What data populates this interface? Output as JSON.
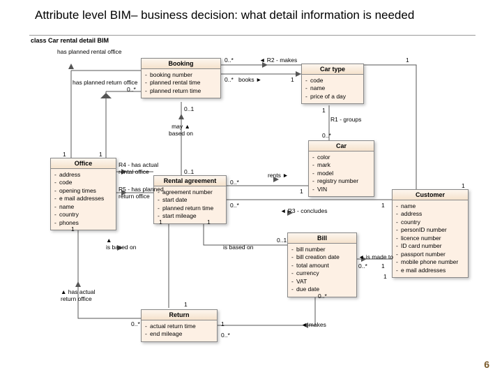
{
  "slide": {
    "title": "Attribute level BIM– business decision: what detail information is needed",
    "page_number": "6"
  },
  "diagram_label": "class Car rental detail BIM",
  "classes": {
    "booking": {
      "name": "Booking",
      "attrs": [
        "booking number",
        "planned rental time",
        "planned return time"
      ]
    },
    "cartype": {
      "name": "Car type",
      "attrs": [
        "code",
        "name",
        "price of a day"
      ]
    },
    "car": {
      "name": "Car",
      "attrs": [
        "color",
        "mark",
        "model",
        "registry number",
        "VIN"
      ]
    },
    "office": {
      "name": "Office",
      "attrs": [
        "address",
        "code",
        "opening times",
        "e mail addresses",
        "name",
        "country",
        "phones"
      ]
    },
    "rental": {
      "name": "Rental agreement",
      "attrs": [
        "agreement number",
        "start date",
        "planned return time",
        "start mileage"
      ]
    },
    "bill": {
      "name": "Bill",
      "attrs": [
        "bill number",
        "bill creation date",
        "total amount",
        "currency",
        "VAT",
        "due date"
      ]
    },
    "customer": {
      "name": "Customer",
      "attrs": [
        "name",
        "address",
        "country",
        "personID number",
        "licence number",
        "ID card number",
        "passport number",
        "mobile phone number",
        "e mail addresses"
      ]
    },
    "return": {
      "name": "Return",
      "attrs": [
        "actual return time",
        "end mileage"
      ]
    }
  },
  "labels": {
    "hasPlannedRentalOffice": "has planned rental office",
    "hasPlannedReturnOffice": "has planned return office",
    "r2makes": "R2 - makes",
    "books": "books",
    "mayBasedOn": "may based on",
    "r1groups": "R1 - groups",
    "r4": "R4 - has actual rental office",
    "r5": "R5 - has planned return office",
    "rents": "rents",
    "r3": "R3 - concludes",
    "isBasedOn1": "is based on",
    "isBasedOn2": "is based on",
    "isMadeTo": "is made to",
    "makes": "makes",
    "hasActualReturnOffice": "has actual return office"
  },
  "mults": {
    "m0s": "0..*",
    "m01": "0..1",
    "m1": "1",
    "m0sAlt": "0..*"
  }
}
